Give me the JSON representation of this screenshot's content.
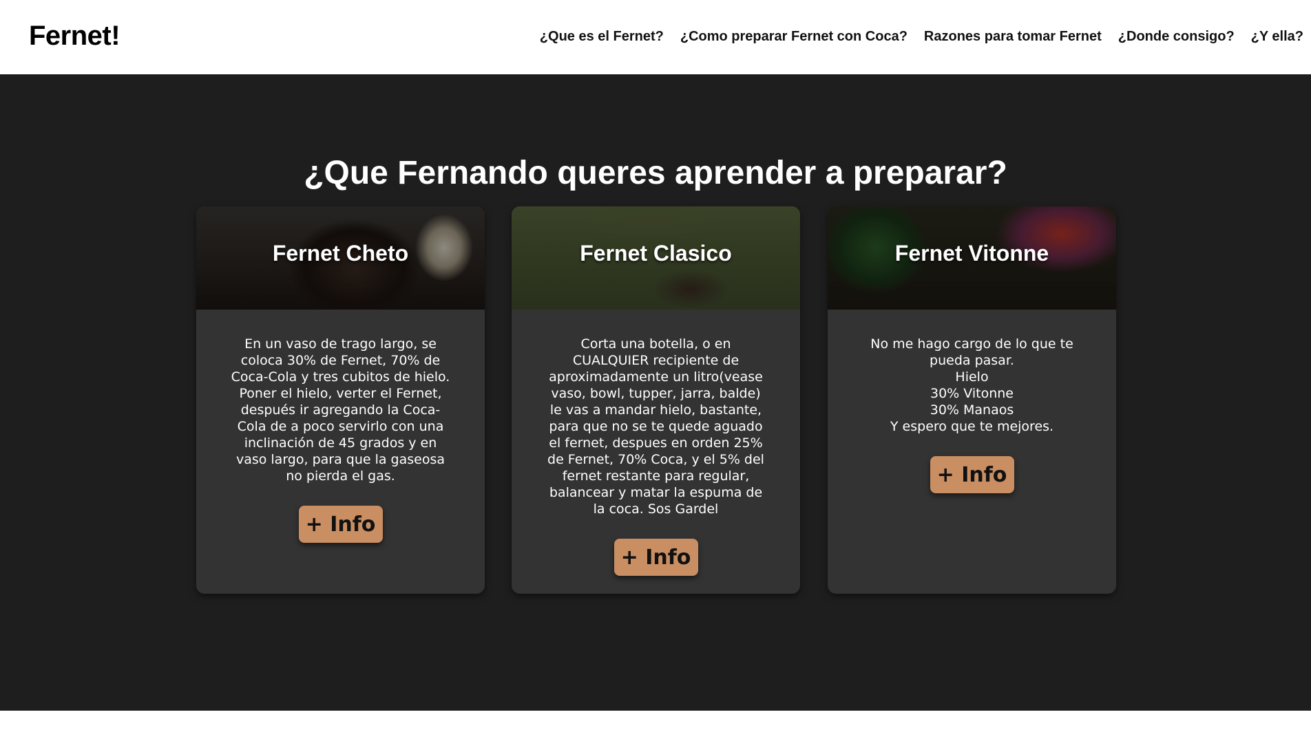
{
  "navbar": {
    "brand": "Fernet!",
    "links": [
      "¿Que es el Fernet?",
      "¿Como preparar Fernet con Coca?",
      "Razones para tomar Fernet",
      "¿Donde consigo?",
      "¿Y ella?"
    ]
  },
  "hero": {
    "title": "¿Que Fernando queres aprender a preparar?"
  },
  "cards": [
    {
      "title": "Fernet Cheto",
      "text": "En un vaso de trago largo, se coloca 30% de Fernet, 70% de Coca-Cola y tres cubitos de hielo. Poner el hielo, verter el Fernet, después ir agregando la Coca-Cola de a poco servirlo con una inclinación de 45 grados y en vaso largo, para que la gaseosa no pierda el gas.",
      "button": "+ Info"
    },
    {
      "title": "Fernet Clasico",
      "text": "Corta una botella, o en CUALQUIER recipiente de aproximadamente un litro(vease vaso, bowl, tupper, jarra, balde) le vas a mandar hielo, bastante, para que no se te quede aguado el fernet, despues en orden 25% de Fernet, 70% Coca, y el 5% del fernet restante para regular, balancear y matar la espuma de la coca. Sos Gardel",
      "button": "+ Info"
    },
    {
      "title": "Fernet Vitonne",
      "text": "No me hago cargo de lo que te pueda pasar.\nHielo\n30% Vitonne\n30% Manaos\nY espero que te mejores.",
      "button": "+ Info"
    }
  ],
  "colors": {
    "hero_background": "#1e1e1e",
    "card_background": "#333333",
    "button_background": "#c98e62"
  }
}
